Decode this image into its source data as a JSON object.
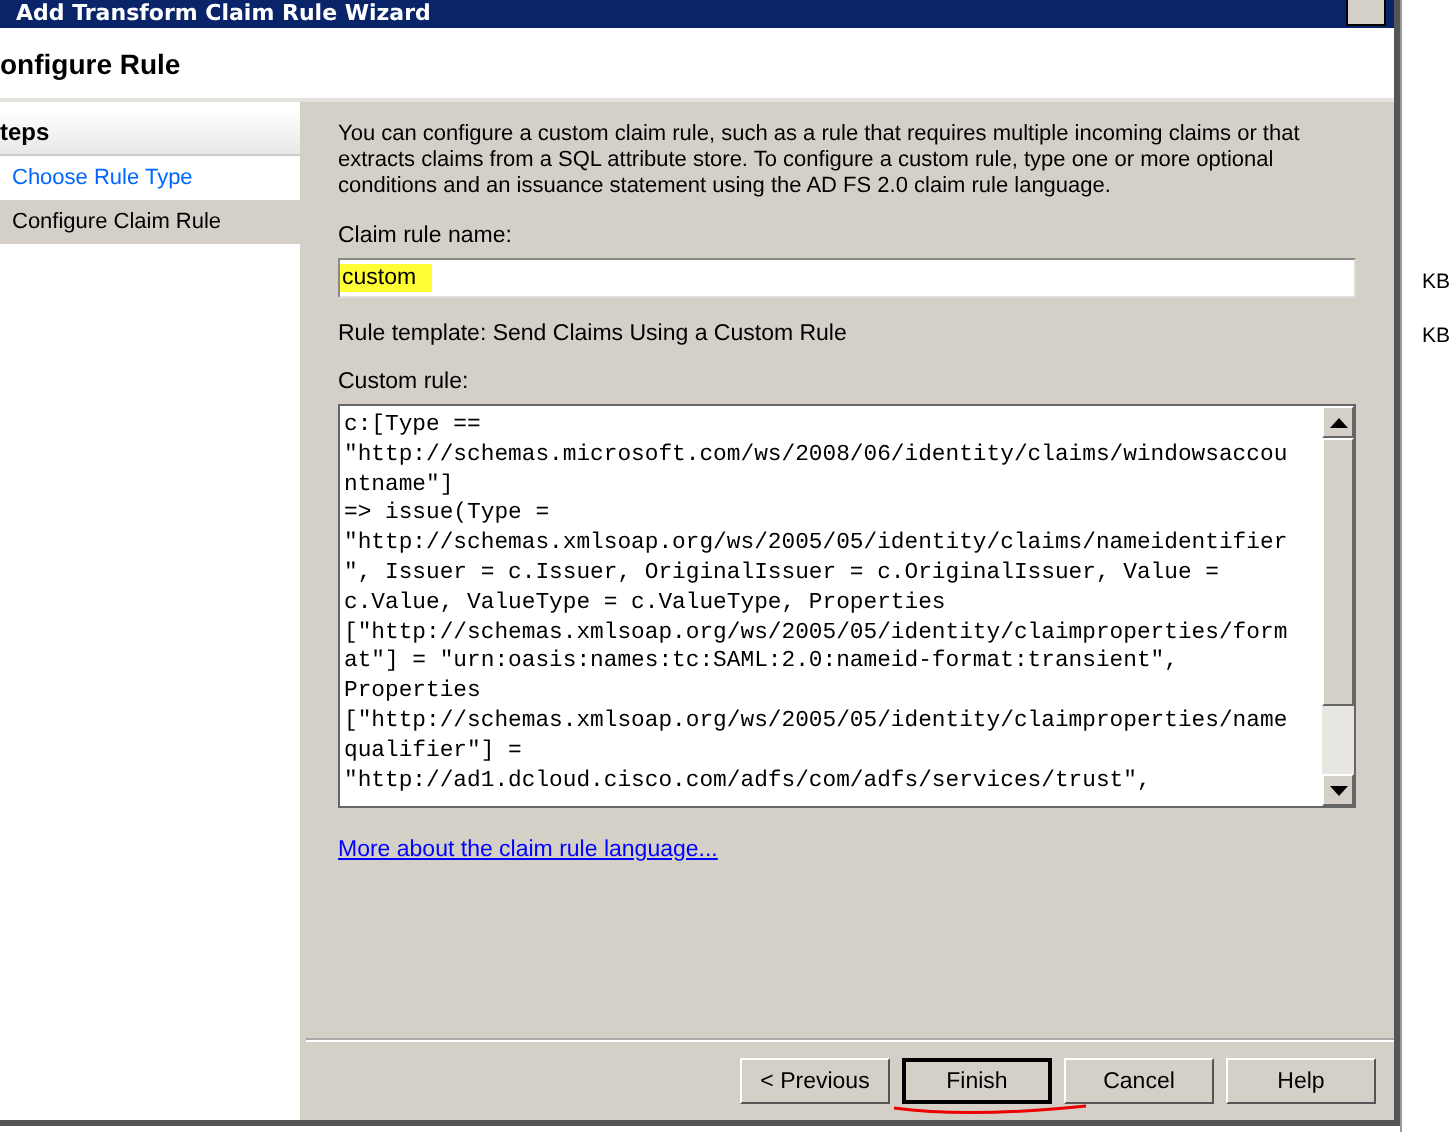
{
  "window": {
    "title": "Add Transform Claim Rule Wizard"
  },
  "header": {
    "title": "onfigure Rule"
  },
  "steps": {
    "title": "teps",
    "items": [
      {
        "label": "Choose Rule Type",
        "selected": false
      },
      {
        "label": "Configure Claim Rule",
        "selected": true
      }
    ]
  },
  "intro": "You can configure a custom claim rule, such as a rule that requires multiple incoming claims or that extracts claims from a SQL attribute store. To configure a custom rule, type one or more optional conditions and an issuance statement using the AD FS 2.0 claim rule language.",
  "name_field": {
    "label": "Claim rule name:",
    "value": "custom"
  },
  "template": "Rule template: Send Claims Using a Custom Rule",
  "custom_rule": {
    "label": "Custom rule:",
    "lines": [
      "c:[Type ==",
      "\"http://schemas.microsoft.com/ws/2008/06/identity/claims/windowsaccou",
      "ntname\"]",
      "=> issue(Type =",
      "\"http://schemas.xmlsoap.org/ws/2005/05/identity/claims/nameidentifier",
      "\", Issuer = c.Issuer, OriginalIssuer = c.OriginalIssuer, Value =",
      "c.Value, ValueType = c.ValueType, Properties",
      "[\"http://schemas.xmlsoap.org/ws/2005/05/identity/claimproperties/form",
      "at\"] = \"urn:oasis:names:tc:SAML:2.0:nameid-format:transient\",",
      "Properties",
      "[\"http://schemas.xmlsoap.org/ws/2005/05/identity/claimproperties/name",
      "qualifier\"] =",
      "\"http://ad1.dcloud.cisco.com/adfs/com/adfs/services/trust\","
    ]
  },
  "link": "More about the claim rule language...",
  "buttons": [
    {
      "label": "< Previous",
      "default": false
    },
    {
      "label": "Finish",
      "default": true
    },
    {
      "label": "Cancel",
      "default": false
    },
    {
      "label": "Help",
      "default": false
    }
  ],
  "background_window": {
    "sizes": [
      "KB",
      "KB"
    ]
  }
}
